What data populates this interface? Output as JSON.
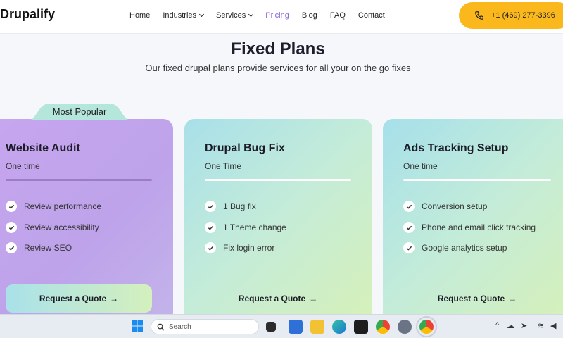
{
  "header": {
    "logo": "Drupalify",
    "nav": [
      "Home",
      "Industries",
      "Services",
      "Pricing",
      "Blog",
      "FAQ",
      "Contact"
    ],
    "phone": "+1 (469) 277-3396",
    "accent": "#fbb81c",
    "active_nav_color": "#8a64d6"
  },
  "hero": {
    "title": "Fixed Plans",
    "subtitle": "Our fixed drupal plans provide services for all your on the go fixes"
  },
  "badge": "Most Popular",
  "plans": [
    {
      "title": "Website Audit",
      "frequency": "One time",
      "features": [
        "Review performance",
        "Review accessibility",
        "Review SEO"
      ],
      "cta": "Request a Quote"
    },
    {
      "title": "Drupal Bug Fix",
      "frequency": "One Time",
      "features": [
        "1 Bug fix",
        "1 Theme change",
        "Fix login error"
      ],
      "cta": "Request a Quote"
    },
    {
      "title": "Ads Tracking Setup",
      "frequency": "One time",
      "features": [
        "Conversion setup",
        "Phone and email click tracking",
        "Google analytics setup"
      ],
      "cta": "Request a Quote"
    }
  ],
  "taskbar": {
    "search_placeholder": "Search",
    "icons": [
      "windows-start-icon",
      "file-explorer-icon",
      "store-icon",
      "folder-icon",
      "edge-icon",
      "terminal-icon",
      "chrome-icon",
      "settings-icon",
      "chrome-icon"
    ]
  }
}
